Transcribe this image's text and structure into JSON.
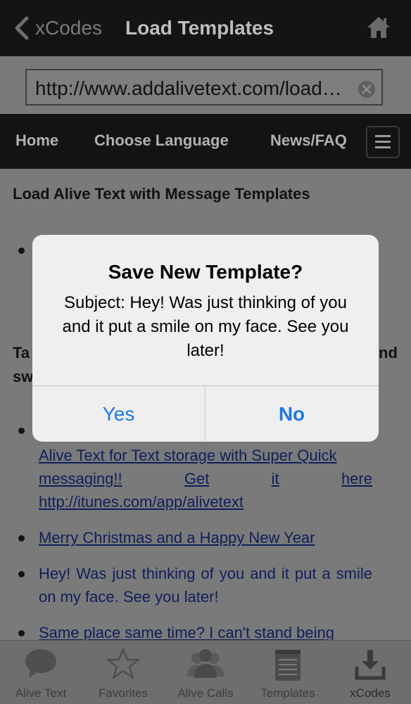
{
  "navbar": {
    "back_label": "xCodes",
    "title": "Load Templates"
  },
  "url": {
    "value": "http://www.addalivetext.com/load-templates"
  },
  "site_menu": {
    "items": [
      "Home",
      "Choose Language",
      "News/FAQ"
    ]
  },
  "content": {
    "heading": "Load Alive Text with Message Templates",
    "tap_fragment": "Ta",
    "and_fragment": "nd",
    "sw_fragment": "sw",
    "item_alive_text": "Alive Text for Text storage with Super Quick messaging!! Get it here http://itunes.com/app/alivetext",
    "item_alive_text_line1": "Alive Text for Text storage with Super Quick",
    "item_alive_text_line2a": "messaging!!",
    "item_alive_text_line2b": "Get",
    "item_alive_text_line2c": "it",
    "item_alive_text_line2d": "here",
    "item_alive_text_line3": "http://itunes.com/app/alivetext",
    "item_christmas": "Merry Christmas and a Happy New Year",
    "item_thinking": "Hey! Was just thinking of you and it put a smile on my face. See you later!",
    "item_same_place": "Same place same time? I can't stand being"
  },
  "dialog": {
    "title": "Save New Template?",
    "message": "Subject: Hey! Was just thinking of you and it put a smile on my face. See you later!",
    "yes_label": "Yes",
    "no_label": "No"
  },
  "tabbar": {
    "tabs": [
      {
        "label": "Alive Text",
        "icon": "speech-bubble-icon"
      },
      {
        "label": "Favorites",
        "icon": "star-icon"
      },
      {
        "label": "Alive Calls",
        "icon": "people-icon"
      },
      {
        "label": "Templates",
        "icon": "notepad-icon"
      },
      {
        "label": "xCodes",
        "icon": "download-tray-icon"
      }
    ]
  },
  "colors": {
    "link": "#0f1f5c",
    "dialog_button": "#1e78e4",
    "overlay_bg": "#7a7a7a"
  }
}
